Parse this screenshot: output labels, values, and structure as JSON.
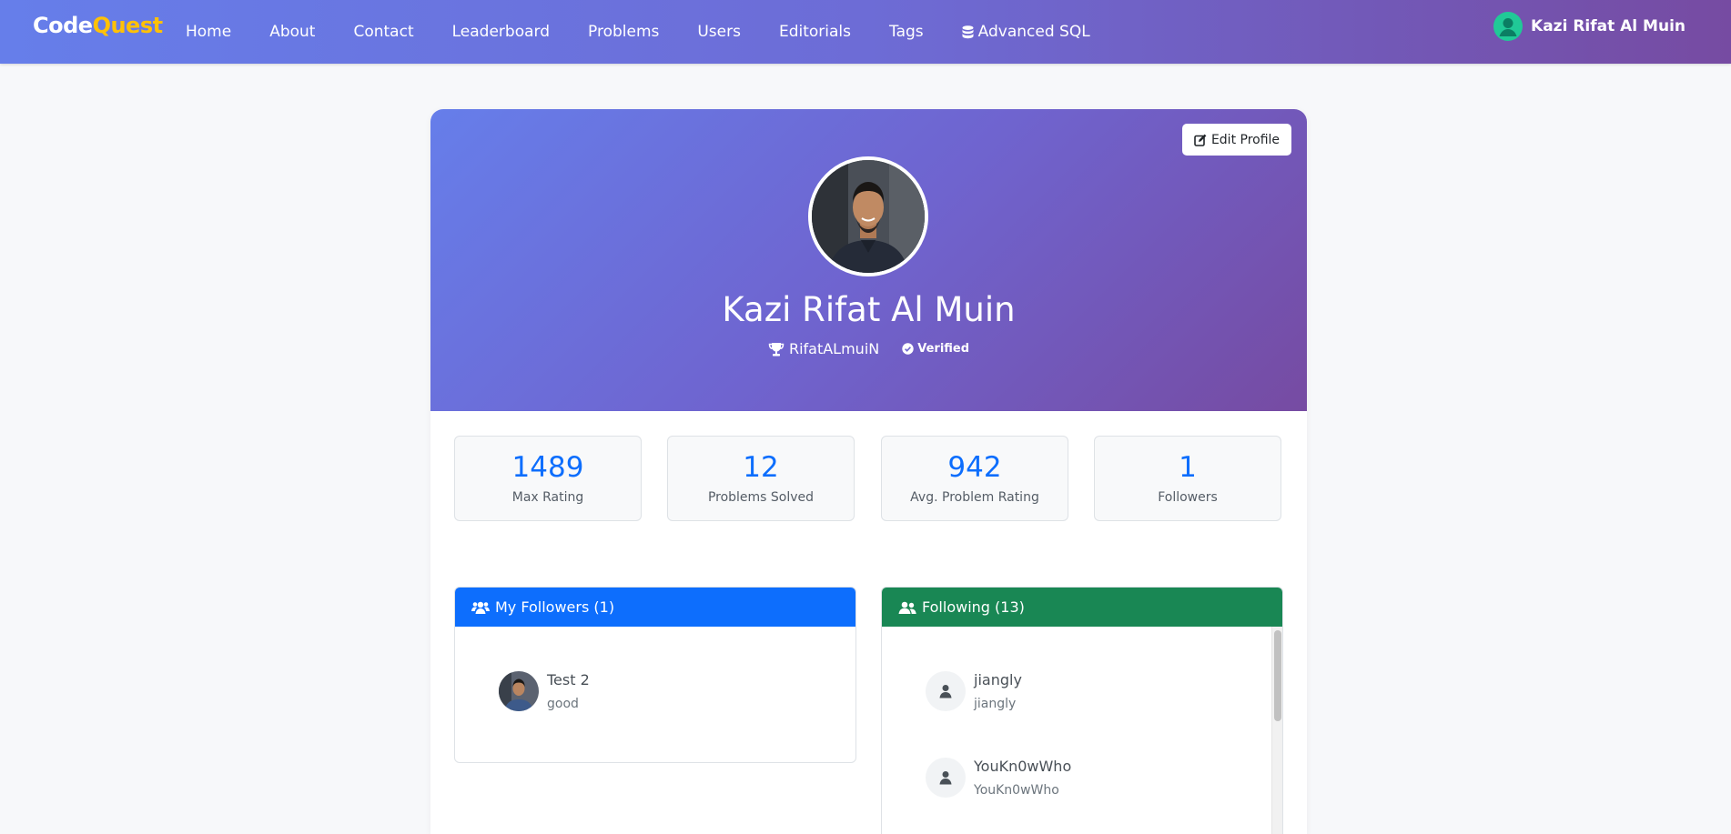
{
  "navbar": {
    "brand_part1": "Code",
    "brand_part2": "Quest",
    "links": [
      "Home",
      "About",
      "Contact",
      "Leaderboard",
      "Problems",
      "Users",
      "Editorials",
      "Tags",
      "Advanced SQL"
    ],
    "user_name": "Kazi Rifat Al Muin"
  },
  "profile": {
    "edit_label": "Edit Profile",
    "name": "Kazi Rifat Al Muin",
    "handle": "RifatALmuiN",
    "verified_label": "Verified"
  },
  "stats": [
    {
      "value": "1489",
      "label": "Max Rating"
    },
    {
      "value": "12",
      "label": "Problems Solved"
    },
    {
      "value": "942",
      "label": "Avg. Problem Rating"
    },
    {
      "value": "1",
      "label": "Followers"
    }
  ],
  "followers": {
    "title": "My Followers (1)",
    "items": [
      {
        "name": "Test 2",
        "sub": "good"
      }
    ]
  },
  "following": {
    "title": "Following (13)",
    "items": [
      {
        "name": "jiangly",
        "sub": "jiangly"
      },
      {
        "name": "YouKn0wWho",
        "sub": "YouKn0wWho"
      }
    ]
  },
  "colors": {
    "brand_accent": "#ffc107",
    "nav_gradient_start": "#667eea",
    "nav_gradient_end": "#764ba2",
    "stat_value": "#0d6efd",
    "followers_header": "#0d6efd",
    "following_header": "#198754"
  },
  "icons": {
    "advanced_sql": "database-icon",
    "edit": "edit-icon",
    "handle": "trophy-icon",
    "verified": "check-circle-icon",
    "list_header": "users-icon",
    "default_avatar": "person-icon"
  }
}
